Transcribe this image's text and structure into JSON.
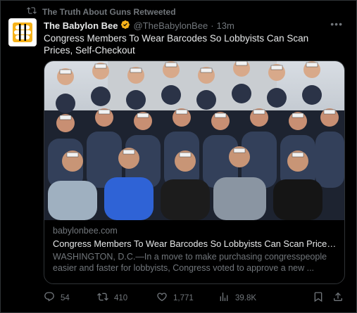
{
  "retweet": {
    "text": "The Truth About Guns Retweeted",
    "icon": "retweet-icon"
  },
  "author": {
    "display_name": "The Babylon Bee",
    "handle": "@TheBabylonBee",
    "separator": "·",
    "time": "13m",
    "verified_color": "#f6b21a"
  },
  "tweet": {
    "text": "Congress Members To Wear Barcodes So Lobbyists Can Scan Prices, Self-Checkout"
  },
  "card": {
    "domain": "babylonbee.com",
    "title": "Congress Members To Wear Barcodes So Lobbyists Can Scan Prices...",
    "description": "WASHINGTON, D.C.—In a move to make purchasing congresspeople easier and faster for lobbyists, Congress voted to approve a new ..."
  },
  "actions": {
    "replies": "54",
    "retweets": "410",
    "likes": "1,771",
    "views": "39.8K"
  },
  "colors": {
    "background": "#000000",
    "text": "#e7e9ea",
    "muted": "#71767b",
    "border": "#2f3336"
  }
}
